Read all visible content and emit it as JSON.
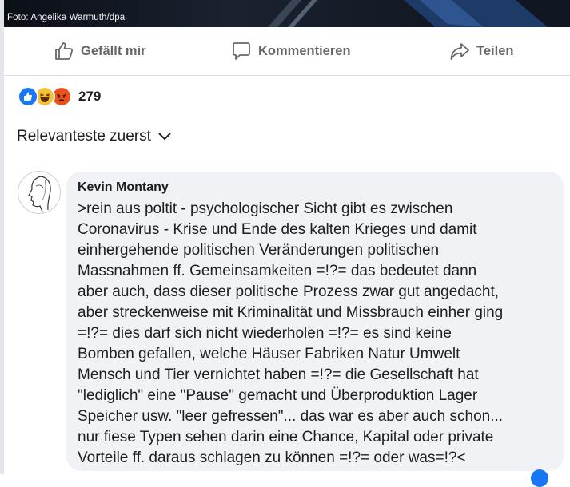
{
  "photo": {
    "credit": "Foto: Angelika Warmuth/dpa"
  },
  "actions": {
    "like_label": "Gefällt mir",
    "comment_label": "Kommentieren",
    "share_label": "Teilen"
  },
  "reactions": {
    "icons": [
      "like-reaction-icon",
      "haha-reaction-icon",
      "angry-reaction-icon"
    ],
    "count": "279"
  },
  "sort": {
    "label": "Relevanteste zuerst"
  },
  "comment": {
    "author": "Kevin Montany",
    "text": ">rein aus poltit - psychologischer Sicht gibt es zwischen\nCoronavirus - Krise und Ende des kalten Krieges und damit\neinhergehende politischen Veränderungen politischen\nMassnahmen ff. Gemeinsamkeiten =!?= das bedeutet dann\naber auch, dass dieser politische Prozess zwar gut angedacht,\naber streckenweise mit Kriminalität und Missbrauch einher ging\n=!?= dies darf sich nicht wiederholen =!?= es sind keine\nBomben gefallen, welche Häuser Fabriken Natur Umwelt\nMensch und  Tier vernichtet haben =!?= die Gesellschaft hat\n\"lediglich\" eine \"Pause\" gemacht und Überproduktion Lager\nSpeicher usw. \"leer gefressen\"... das war es aber auch schon...\nnur fiese Typen sehen darin eine Chance, Kapital oder private\nVorteile ff. daraus schlagen zu können =!?= oder was=!?<"
  },
  "colors": {
    "muted_text": "#65676b",
    "bubble_bg": "#f0f2f5",
    "like_blue": "#1877f2",
    "divider": "#dadde1"
  }
}
